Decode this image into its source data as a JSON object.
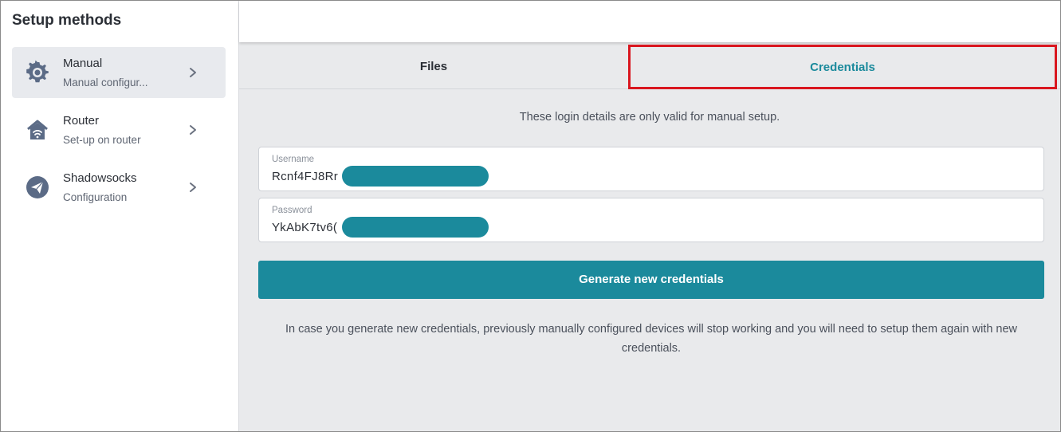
{
  "sidebar": {
    "title": "Setup methods",
    "items": [
      {
        "label": "Manual",
        "sublabel": "Manual configur...",
        "icon": "gear-icon",
        "active": true
      },
      {
        "label": "Router",
        "sublabel": "Set-up on router",
        "icon": "router-icon",
        "active": false
      },
      {
        "label": "Shadowsocks",
        "sublabel": "Configuration",
        "icon": "paper-plane-icon",
        "active": false
      }
    ]
  },
  "tabs": {
    "files": "Files",
    "credentials": "Credentials",
    "active": "credentials"
  },
  "main": {
    "info": "These login details are only valid for manual setup.",
    "username": {
      "label": "Username",
      "value": "Rcnf4FJ8Rr"
    },
    "password": {
      "label": "Password",
      "value": "YkAbK7tv6("
    },
    "generate_button": "Generate new credentials",
    "warning": "In case you generate new credentials, previously manually configured devices will stop working and you will need to setup them again with new credentials."
  },
  "colors": {
    "accent": "#1b8a9c",
    "highlight_border": "#d9161f",
    "sidebar_active_bg": "#e8eaee",
    "main_bg": "#e9eaec"
  }
}
